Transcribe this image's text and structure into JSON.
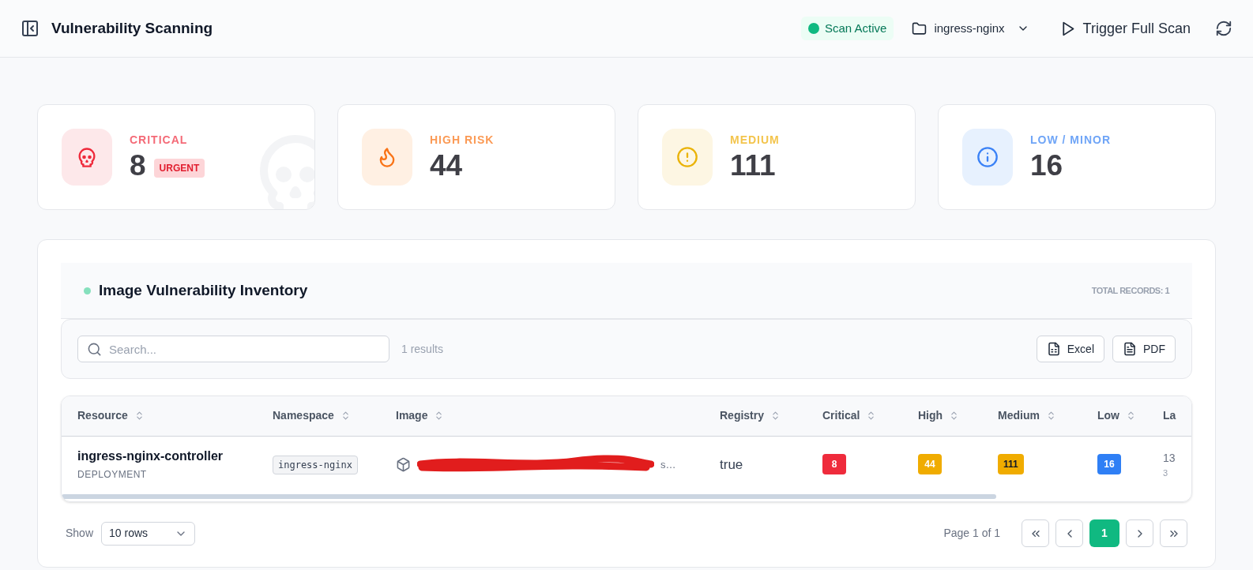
{
  "header": {
    "title": "Vulnerability Scanning",
    "status": {
      "label": "Scan Active",
      "active": true
    },
    "namespace": "ingress-nginx",
    "action": "Trigger Full Scan"
  },
  "stats": [
    {
      "kind": "critical",
      "label": "CRITICAL",
      "value": "8",
      "badge": "URGENT"
    },
    {
      "kind": "high",
      "label": "HIGH RISK",
      "value": "44"
    },
    {
      "kind": "medium",
      "label": "MEDIUM",
      "value": "111"
    },
    {
      "kind": "low",
      "label": "LOW / MINOR",
      "value": "16"
    }
  ],
  "inventory": {
    "title": "Image Vulnerability Inventory",
    "total": "TOTAL RECORDS: 1",
    "search": {
      "placeholder": "Search..."
    },
    "results": "1 results",
    "exports": [
      {
        "kind": "excel",
        "label": "Excel"
      },
      {
        "kind": "pdf",
        "label": "PDF"
      }
    ],
    "table": {
      "columns": [
        "Resource",
        "Namespace",
        "Image",
        "Registry",
        "Critical",
        "High",
        "Medium",
        "Low",
        "La"
      ],
      "rows": [
        {
          "resource": "ingress-nginx-controller",
          "kind": "DEPLOYMENT",
          "namespace": "ingress-nginx",
          "image": "s…",
          "registry": "true",
          "critical": "8",
          "high": "44",
          "medium": "111",
          "low": "16",
          "column_9": "13",
          "column_9_sub": "3"
        }
      ]
    },
    "footer": {
      "show": "Show",
      "rows": "10 rows",
      "page": "Page 1 of 1",
      "pages": [
        {
          "label": "1",
          "selected": true
        }
      ]
    }
  }
}
